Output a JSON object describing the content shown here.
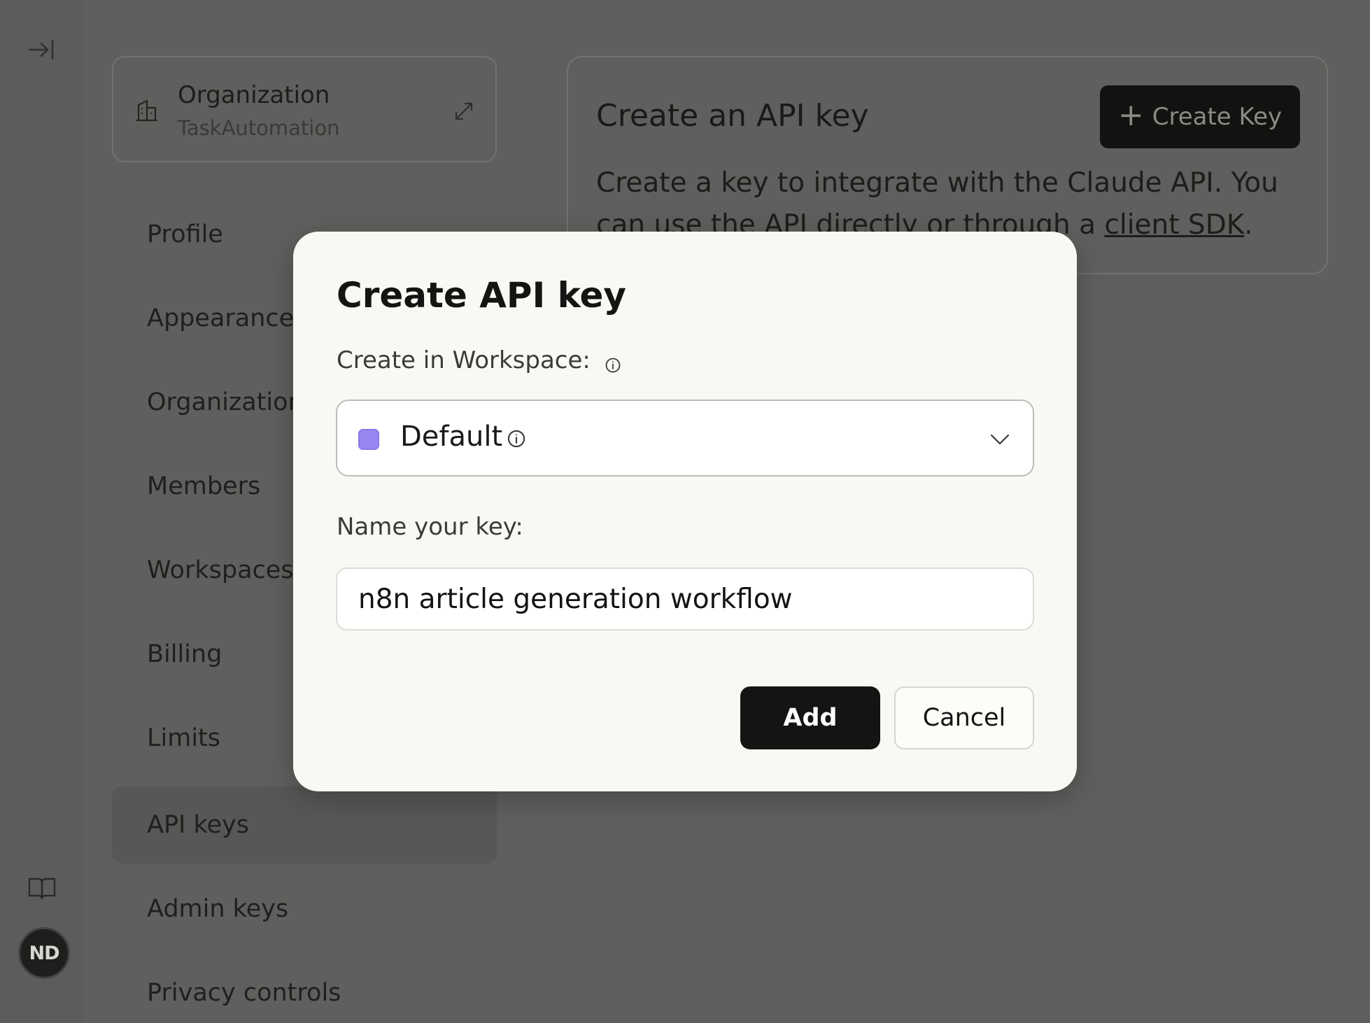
{
  "sidebar": {
    "org_title": "Organization",
    "org_name": "TaskAutomation",
    "nav_items": [
      {
        "label": "Profile"
      },
      {
        "label": "Appearance"
      },
      {
        "label": "Organization"
      },
      {
        "label": "Members"
      },
      {
        "label": "Workspaces"
      },
      {
        "label": "Billing"
      },
      {
        "label": "Limits"
      },
      {
        "label": "API keys",
        "active": true
      },
      {
        "label": "Admin keys"
      },
      {
        "label": "Privacy controls"
      }
    ],
    "avatar_initials": "ND"
  },
  "main": {
    "card_title": "Create an API key",
    "create_key_label": "Create Key",
    "desc_before_link": "Create a key to integrate with the Claude API. You can use the API directly or through a ",
    "desc_link": "client SDK",
    "desc_after_link": "."
  },
  "modal": {
    "title": "Create API key",
    "workspace_label": "Create in Workspace:",
    "workspace_selected": "Default",
    "workspace_color": "#9a86f0",
    "name_label": "Name your key:",
    "name_value": "n8n article generation workflow",
    "add_label": "Add",
    "cancel_label": "Cancel"
  },
  "icons": {
    "collapse": "collapse-sidebar-icon",
    "docs": "book-icon",
    "org": "building-icon",
    "expand": "expand-icon",
    "plus": "plus-icon",
    "info": "info-icon",
    "chevron": "chevron-down-icon"
  }
}
